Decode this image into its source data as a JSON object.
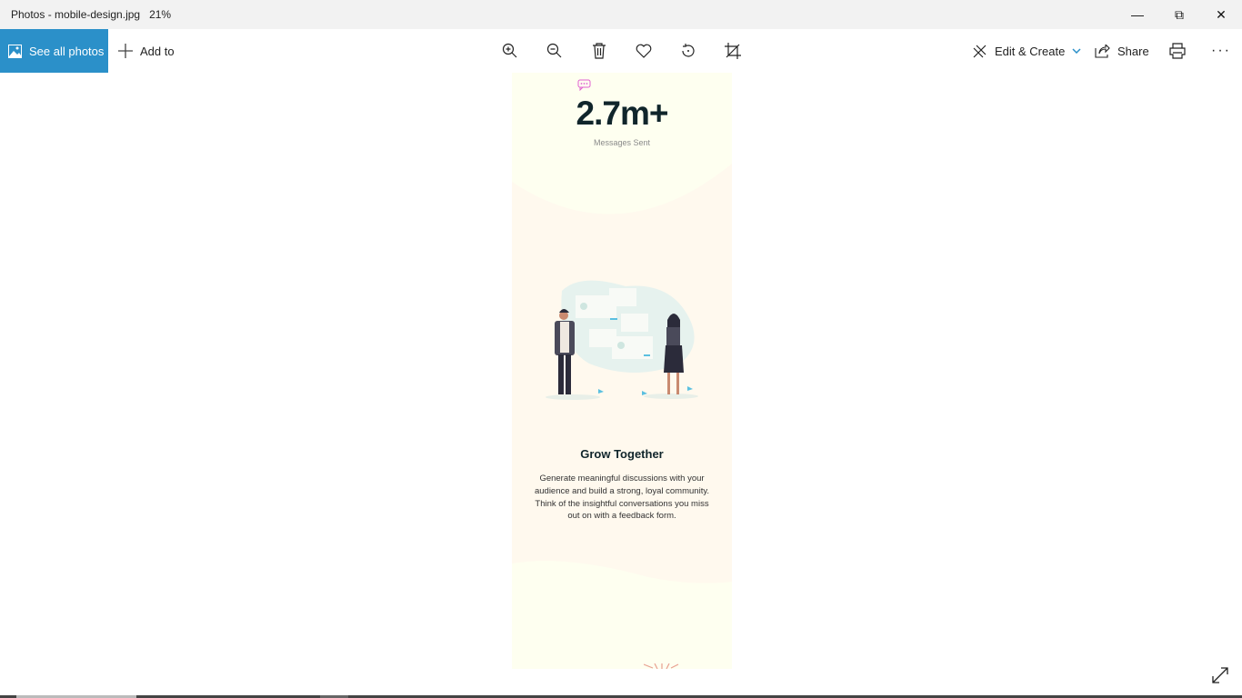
{
  "window": {
    "title": "Photos - mobile-design.jpg",
    "zoom": "21%"
  },
  "toolbar": {
    "see_all": "See all photos",
    "add_to": "Add to",
    "edit_create": "Edit & Create",
    "share": "Share"
  },
  "photo": {
    "stat_value": "2.7m+",
    "stat_label": "Messages Sent",
    "heading": "Grow Together",
    "body": "Generate meaningful discussions with your audience and build a strong, loyal community. Think of the insightful conversations you miss out on with a feedback form."
  },
  "colors": {
    "accent": "#2b90c9",
    "photo_bg": "#fefff0",
    "section_bg": "#fff9ee"
  }
}
